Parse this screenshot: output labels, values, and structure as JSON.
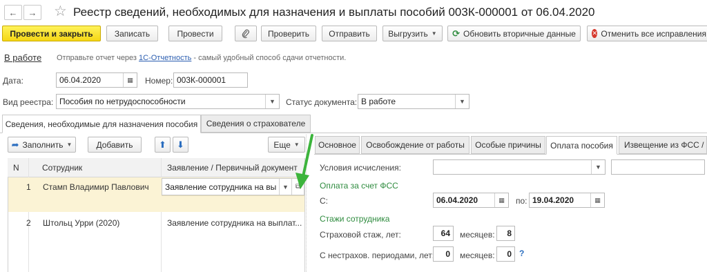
{
  "header": {
    "title": "Реестр сведений, необходимых для назначения и выплаты пособий 003К-000001 от 06.04.2020"
  },
  "toolbar": {
    "post_close": "Провести и закрыть",
    "save": "Записать",
    "post": "Провести",
    "check": "Проверить",
    "send": "Отправить",
    "export": "Выгрузить",
    "refresh": "Обновить вторичные данные",
    "cancel_fixes": "Отменить все исправления"
  },
  "status_bar": {
    "status": "В работе",
    "hint_before": "Отправьте отчет через ",
    "hint_link": "1С-Отчетность",
    "hint_after": " - самый удобный способ сдачи отчетности."
  },
  "form": {
    "date_label": "Дата:",
    "date_value": "06.04.2020",
    "number_label": "Номер:",
    "number_value": "003К-000001",
    "registry_type_label": "Вид реестра:",
    "registry_type_value": "Пособия по нетрудоспособности",
    "doc_status_label": "Статус документа:",
    "doc_status_value": "В работе"
  },
  "main_tabs": [
    {
      "label": "Сведения, необходимые для назначения пособия"
    },
    {
      "label": "Сведения о страхователе"
    }
  ],
  "list_toolbar": {
    "fill": "Заполнить",
    "add": "Добавить",
    "more": "Еще"
  },
  "table": {
    "columns": [
      "N",
      "Сотрудник",
      "Заявление / Первичный документ"
    ],
    "rows": [
      {
        "n": "1",
        "employee": "Стамп Владимир Павлович",
        "doc": "Заявление сотрудника на вы"
      },
      {
        "n": "2",
        "employee": "Штольц Урри (2020)",
        "doc": "Заявление сотрудника на выплат..."
      }
    ]
  },
  "detail_tabs": [
    {
      "label": "Основное"
    },
    {
      "label": "Освобождение от работы"
    },
    {
      "label": "Особые причины"
    },
    {
      "label": "Оплата пособия"
    },
    {
      "label": "Извещение из ФСС /"
    }
  ],
  "detail": {
    "conditions_label": "Условия исчисления:",
    "fss_heading": "Оплата за счет ФСС",
    "from_label": "С:",
    "from_value": "06.04.2020",
    "to_label": "по:",
    "to_value": "19.04.2020",
    "experience_heading": "Стажи сотрудника",
    "insurance_label": "Страховой стаж, лет:",
    "insurance_years": "64",
    "months_label": "месяцев:",
    "insurance_months": "8",
    "noninsurance_label": "С нестрахов. периодами, лет:",
    "noninsurance_years": "0",
    "noninsurance_months": "0",
    "help": "?"
  },
  "colors": {
    "primary_button": "#f5d614",
    "selected_row": "#fbf3d5",
    "green_heading": "#2e8b3e",
    "annotation_arrow": "#3cb43c"
  }
}
